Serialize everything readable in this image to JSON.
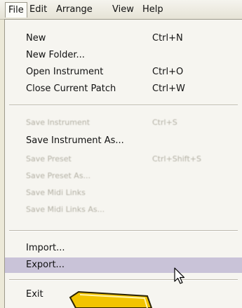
{
  "menubar": {
    "items": [
      "File",
      "Edit",
      "Arrange",
      "View",
      "Help"
    ]
  },
  "file_menu": {
    "items": [
      {
        "label": "New",
        "shortcut": "Ctrl+N"
      },
      {
        "label": "New Folder...",
        "shortcut": ""
      },
      {
        "label": "Open Instrument",
        "shortcut": "Ctrl+O"
      },
      {
        "label": "Close Current Patch",
        "shortcut": "Ctrl+W"
      },
      {
        "label": "Save Instrument",
        "shortcut": "Ctrl+S",
        "disabled": true
      },
      {
        "label": "Save Instrument As...",
        "shortcut": ""
      },
      {
        "label": "Save Preset",
        "shortcut": "Ctrl+Shift+S",
        "disabled": true
      },
      {
        "label": "Save Preset As...",
        "shortcut": "",
        "disabled": true
      },
      {
        "label": "Save Midi Links",
        "shortcut": "",
        "disabled": true
      },
      {
        "label": "Save Midi Links As...",
        "shortcut": "",
        "disabled": true
      },
      {
        "label": "Import...",
        "shortcut": ""
      },
      {
        "label": "Export...",
        "shortcut": "",
        "highlighted": true
      },
      {
        "label": "Exit",
        "shortcut": ""
      }
    ]
  },
  "colors": {
    "menubar_bg": "#ece9d8",
    "menu_bg": "#f6f5f0",
    "highlight": "#c9c3d8",
    "disabled_text": "#b3b0a4",
    "banner_fill": "#f2c400"
  },
  "icons": [
    "mouse-pointer-icon",
    "yellow-banner-graphic"
  ]
}
